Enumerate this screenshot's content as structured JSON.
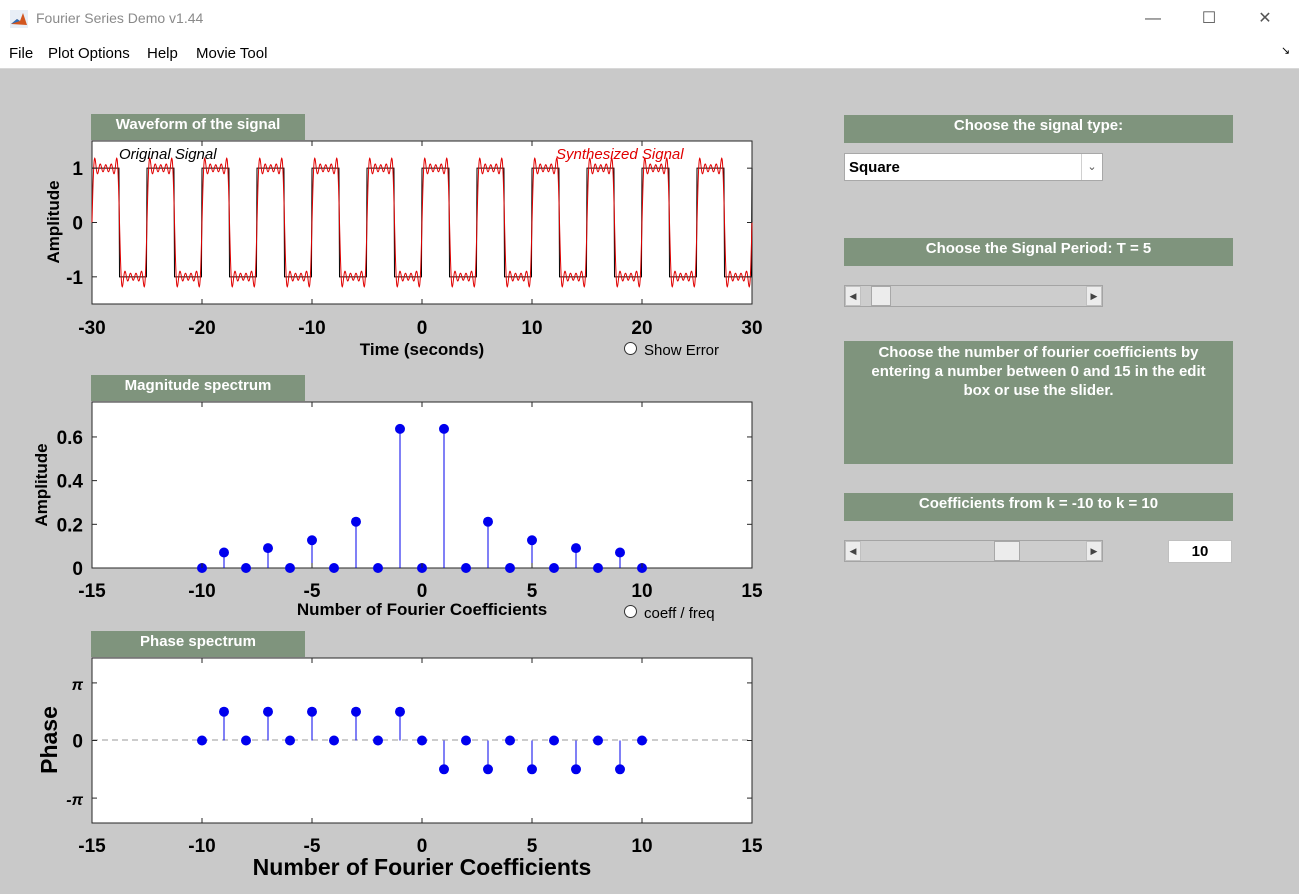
{
  "window": {
    "title": "Fourier Series Demo v1.44",
    "min_icon": "minimize-icon",
    "max_icon": "maximize-icon",
    "close_icon": "close-icon",
    "app_icon": "matlab-icon"
  },
  "menu": {
    "items": [
      "File",
      "Plot Options",
      "Help",
      "Movie Tool"
    ]
  },
  "panels": {
    "waveform": "Waveform of the signal",
    "magnitude": "Magnitude spectrum",
    "phase": "Phase spectrum"
  },
  "controls": {
    "signal_type_label": "Choose the signal type:",
    "signal_type_value": "Square",
    "period_label": "Choose the Signal Period:  T = 5",
    "period_slider_value": 0.05,
    "coeff_instructions": "Choose the number of fourier coefficients by entering a number between 0 and 15 in the edit box or use the slider.",
    "coeff_range_label": "Coefficients from k = -10  to  k = 10",
    "coeff_slider_value": 0.667,
    "coeff_edit_value": "10",
    "show_error_label": "Show Error",
    "coeff_freq_label": "coeff / freq"
  },
  "colors": {
    "panel_header": "#7f947d",
    "background": "#c9c9c9",
    "original": "#000000",
    "synthesized": "#e00000",
    "stem": "#0000ee"
  },
  "chart_data": [
    {
      "type": "line",
      "xlabel": "Time (seconds)",
      "ylabel": "Amplitude",
      "xlim": [
        -30,
        30
      ],
      "ylim": [
        -1.5,
        1.5
      ],
      "xticks": [
        -30,
        -20,
        -10,
        0,
        10,
        20,
        30
      ],
      "yticks": [
        -1,
        0,
        1
      ],
      "legend": [
        "Original Signal",
        "Synthesized Signal"
      ],
      "period": 5,
      "series": [
        {
          "name": "Original Signal",
          "x": [
            -30,
            -27.5,
            -25,
            -22.5,
            -20,
            -17.5,
            -15,
            -12.5,
            -10,
            -7.5,
            -5,
            -2.5,
            0,
            2.5,
            5,
            7.5,
            10,
            12.5,
            15,
            17.5,
            20,
            22.5,
            25,
            27.5,
            30
          ],
          "y": [
            1,
            -1,
            1,
            -1,
            1,
            -1,
            1,
            -1,
            1,
            -1,
            1,
            -1,
            1,
            -1,
            1,
            -1,
            1,
            -1,
            1,
            -1,
            1,
            -1,
            1,
            -1,
            1
          ]
        },
        {
          "name": "Synthesized Signal",
          "harmonics_k": [
            1,
            3,
            5,
            7,
            9
          ]
        }
      ]
    },
    {
      "type": "scatter",
      "xlabel": "Number of Fourier Coefficients",
      "ylabel": "Amplitude",
      "xlim": [
        -15,
        15
      ],
      "ylim": [
        0,
        0.76
      ],
      "xticks": [
        -15,
        -10,
        -5,
        0,
        5,
        10,
        15
      ],
      "yticks": [
        0,
        0.2,
        0.4,
        0.6
      ],
      "x": [
        -10,
        -9,
        -8,
        -7,
        -6,
        -5,
        -4,
        -3,
        -2,
        -1,
        0,
        1,
        2,
        3,
        4,
        5,
        6,
        7,
        8,
        9,
        10
      ],
      "y": [
        0,
        0.071,
        0,
        0.091,
        0,
        0.127,
        0,
        0.212,
        0,
        0.637,
        0,
        0.637,
        0,
        0.212,
        0,
        0.127,
        0,
        0.091,
        0,
        0.071,
        0
      ]
    },
    {
      "type": "scatter",
      "xlabel": "Number of Fourier Coefficients",
      "ylabel": "Phase",
      "xlim": [
        -15,
        15
      ],
      "ylim": [
        -4.5,
        4.5
      ],
      "xticks": [
        -15,
        -10,
        -5,
        0,
        5,
        10,
        15
      ],
      "yticks": [
        "-π",
        "0",
        "π"
      ],
      "x": [
        -10,
        -9,
        -8,
        -7,
        -6,
        -5,
        -4,
        -3,
        -2,
        -1,
        0,
        1,
        2,
        3,
        4,
        5,
        6,
        7,
        8,
        9,
        10
      ],
      "y": [
        0,
        1.571,
        0,
        1.571,
        0,
        1.571,
        0,
        1.571,
        0,
        1.571,
        0,
        -1.571,
        0,
        -1.571,
        0,
        -1.571,
        0,
        -1.571,
        0,
        -1.571,
        0
      ]
    }
  ]
}
